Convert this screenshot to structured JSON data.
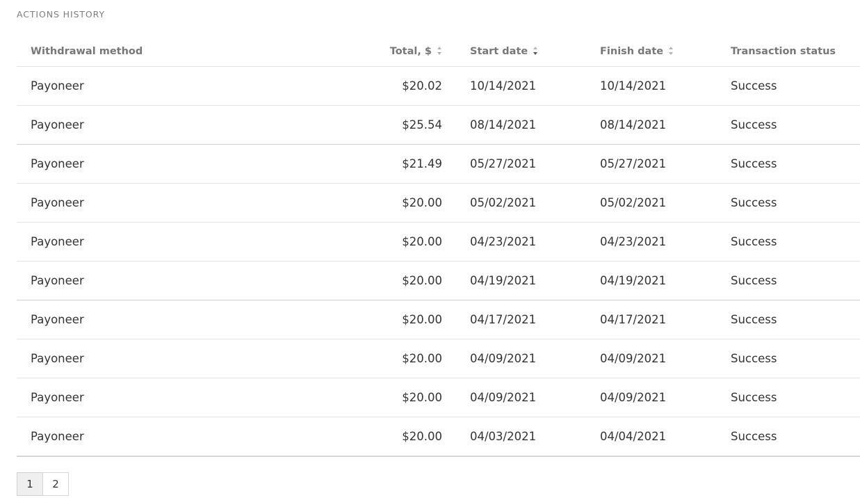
{
  "section_title": "ACTIONS HISTORY",
  "table": {
    "columns": {
      "method": "Withdrawal method",
      "total": "Total, $",
      "start": "Start date",
      "finish": "Finish date",
      "status": "Transaction status"
    },
    "rows": [
      {
        "method": "Payoneer",
        "total": "$20.02",
        "start": "10/14/2021",
        "finish": "10/14/2021",
        "status": "Success"
      },
      {
        "method": "Payoneer",
        "total": "$25.54",
        "start": "08/14/2021",
        "finish": "08/14/2021",
        "status": "Success"
      },
      {
        "method": "Payoneer",
        "total": "$21.49",
        "start": "05/27/2021",
        "finish": "05/27/2021",
        "status": "Success"
      },
      {
        "method": "Payoneer",
        "total": "$20.00",
        "start": "05/02/2021",
        "finish": "05/02/2021",
        "status": "Success"
      },
      {
        "method": "Payoneer",
        "total": "$20.00",
        "start": "04/23/2021",
        "finish": "04/23/2021",
        "status": "Success"
      },
      {
        "method": "Payoneer",
        "total": "$20.00",
        "start": "04/19/2021",
        "finish": "04/19/2021",
        "status": "Success"
      },
      {
        "method": "Payoneer",
        "total": "$20.00",
        "start": "04/17/2021",
        "finish": "04/17/2021",
        "status": "Success"
      },
      {
        "method": "Payoneer",
        "total": "$20.00",
        "start": "04/09/2021",
        "finish": "04/09/2021",
        "status": "Success"
      },
      {
        "method": "Payoneer",
        "total": "$20.00",
        "start": "04/09/2021",
        "finish": "04/09/2021",
        "status": "Success"
      },
      {
        "method": "Payoneer",
        "total": "$20.00",
        "start": "04/03/2021",
        "finish": "04/04/2021",
        "status": "Success"
      }
    ]
  },
  "pagination": {
    "pages": [
      "1",
      "2"
    ],
    "current": "1"
  }
}
